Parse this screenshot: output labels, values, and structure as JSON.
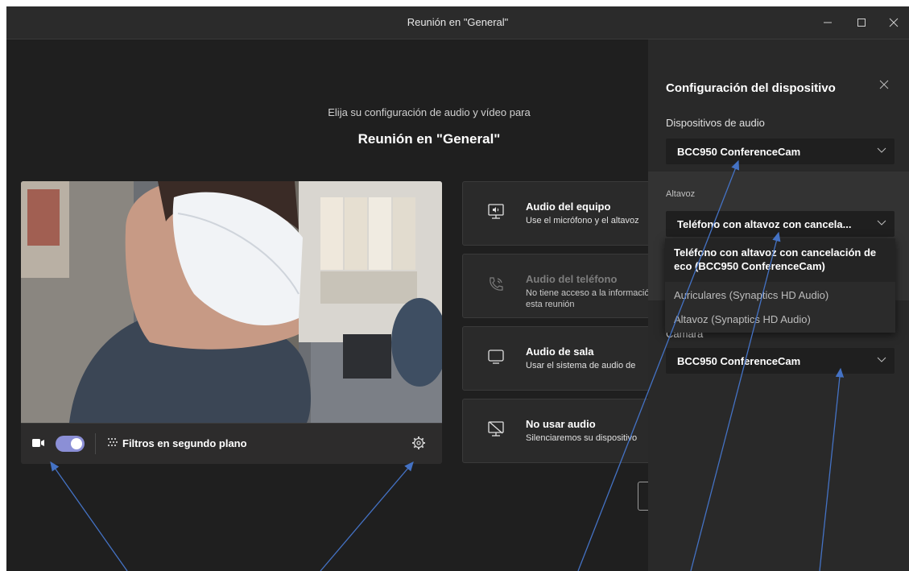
{
  "window": {
    "title": "Reunión en \"General\""
  },
  "prejoin": {
    "subtitle": "Elija su configuración de audio y vídeo para",
    "meeting_name": "Reunión en \"General\"",
    "controls": {
      "filters_label": "Filtros en segundo plano",
      "camera_on": true
    }
  },
  "audio_options": [
    {
      "title": "Audio del equipo",
      "desc": "Use el micrófono y el altavoz"
    },
    {
      "title": "Audio del teléfono",
      "desc": "No tiene acceso a la información de esta reunión"
    },
    {
      "title": "Audio de sala",
      "desc": "Usar el sistema de audio de"
    },
    {
      "title": "No usar audio",
      "desc": "Silenciaremos su dispositivo"
    }
  ],
  "device_panel": {
    "title": "Configuración del dispositivo",
    "audio_devices_label": "Dispositivos de audio",
    "audio_device_value": "BCC950 ConferenceCam",
    "speaker_label": "Altavoz",
    "speaker_value": "Teléfono con altavoz con cancela...",
    "camera_label": "Cámara",
    "camera_value": "BCC950 ConferenceCam",
    "speaker_options": [
      "Teléfono con altavoz con cancelación de eco (BCC950 ConferenceCam)",
      "Auriculares (Synaptics HD Audio)",
      "Altavoz (Synaptics HD Audio)"
    ]
  },
  "colors": {
    "accent": "#8b8fd6",
    "background": "#1f1f1f",
    "annotation_arrow": "#4472c4"
  },
  "icons": [
    "minimize-icon",
    "maximize-icon",
    "close-icon",
    "camera-icon",
    "filters-icon",
    "gear-icon",
    "computer-audio-icon",
    "phone-audio-icon",
    "room-audio-icon",
    "no-audio-icon",
    "chevron-down-icon"
  ]
}
